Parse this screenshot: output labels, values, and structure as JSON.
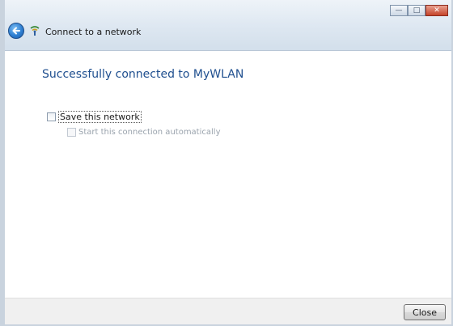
{
  "window": {
    "title": "Connect to a network",
    "caption": {
      "minimize_glyph": "—",
      "maximize_glyph": "□",
      "close_glyph": "✕"
    }
  },
  "icons": {
    "back": "back-arrow-icon",
    "network": "network-icon"
  },
  "main": {
    "heading": "Successfully connected to MyWLAN",
    "save_network": {
      "label": "Save this network",
      "checked": false
    },
    "auto_start": {
      "label": "Start this connection automatically",
      "checked": false,
      "enabled": false
    }
  },
  "footer": {
    "close_label": "Close"
  },
  "colors": {
    "heading": "#1f4f8f",
    "titlebar": "#dde7f1",
    "footer": "#f0f0f0",
    "close_caption": "#c5432a"
  }
}
